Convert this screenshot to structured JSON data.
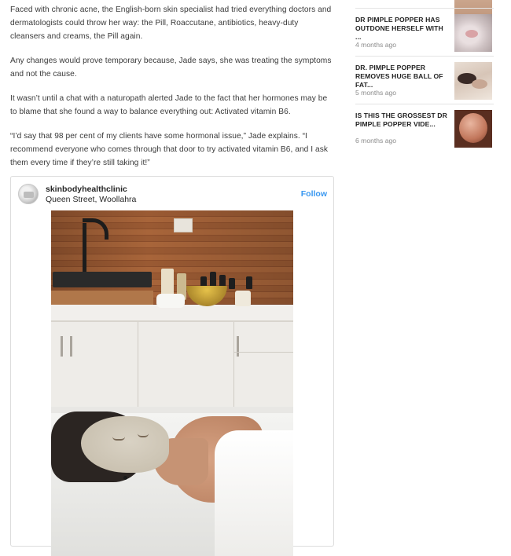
{
  "article": {
    "paragraphs": [
      "Faced with chronic acne, the English-born skin specialist had tried everything doctors and dermatologists could throw her way: the Pill, Roaccutane, antibiotics, heavy-duty cleansers and creams, the Pill again.",
      "Any changes would prove temporary because, Jade says, she was treating the symptoms and not the cause.",
      "It wasn’t until a chat with a naturopath alerted Jade to the fact that her hormones may be to blame that she found a way to balance everything out: Activated vitamin B6.",
      "“I’d say that 98 per cent of my clients have some hormonal issue,” Jade explains. “I recommend everyone who comes through that door to try activated vitamin B6, and I ask them every time if they’re still taking it!”"
    ]
  },
  "embed": {
    "username": "skinbodyhealthclinic",
    "location": "Queen Street, Woollahra",
    "follow_label": "Follow",
    "accent_color": "#3897f0"
  },
  "sidebar": {
    "items": [
      {
        "title": "DR PIMPLE POPPER HAS OUTDONE HERSELF WITH ...",
        "time": "4 months ago"
      },
      {
        "title": "DR. PIMPLE POPPER REMOVES HUGE BALL OF FAT...",
        "time": "5 months ago"
      },
      {
        "title": "IS THIS THE GROSSEST DR PIMPLE POPPER VIDE...",
        "time": "6 months ago"
      }
    ]
  }
}
